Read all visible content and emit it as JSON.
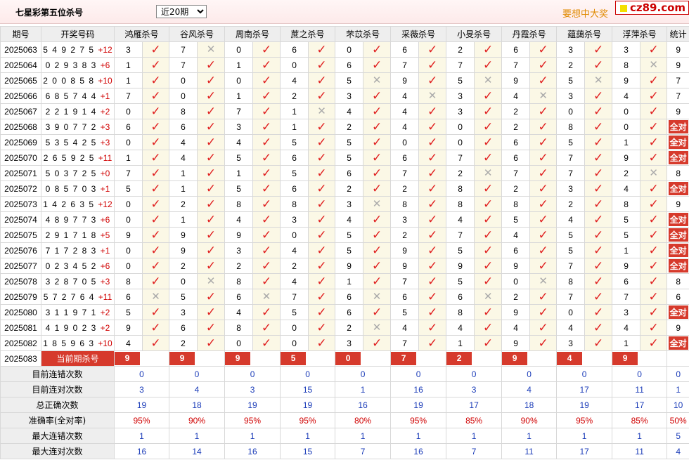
{
  "header": {
    "title": "七星彩第五位杀号",
    "select_value": "近20期",
    "promo": "要想中大奖",
    "logo": "cz89.com"
  },
  "columns": [
    "期号",
    "开奖号码",
    "鸿雁杀号",
    "谷风杀号",
    "周南杀号",
    "蔗之杀号",
    "芣苡杀号",
    "采薇杀号",
    "小旻杀号",
    "丹霞杀号",
    "蕴藹杀号",
    "浮萍杀号",
    "统计"
  ],
  "rows": [
    {
      "issue": "2025063",
      "nums": "5 4 9 2 7 5",
      "plus": "+12",
      "preds": [
        3,
        7,
        0,
        6,
        0,
        6,
        2,
        6,
        3,
        3
      ],
      "marks": [
        1,
        0,
        1,
        1,
        1,
        1,
        1,
        1,
        1,
        1
      ],
      "stat": "9"
    },
    {
      "issue": "2025064",
      "nums": "0 2 9 3 8 3",
      "plus": "+6",
      "preds": [
        1,
        7,
        1,
        0,
        6,
        7,
        7,
        7,
        2,
        8
      ],
      "marks": [
        1,
        1,
        1,
        1,
        1,
        1,
        1,
        1,
        1,
        0
      ],
      "stat": "9"
    },
    {
      "issue": "2025065",
      "nums": "2 0 0 8 5 8",
      "plus": "+10",
      "preds": [
        1,
        0,
        0,
        4,
        5,
        9,
        5,
        9,
        5,
        9
      ],
      "marks": [
        1,
        1,
        1,
        1,
        0,
        1,
        0,
        1,
        0,
        1
      ],
      "stat": "7"
    },
    {
      "issue": "2025066",
      "nums": "6 8 5 7 4 4",
      "plus": "+1",
      "preds": [
        7,
        0,
        1,
        2,
        3,
        4,
        3,
        4,
        3,
        4
      ],
      "marks": [
        1,
        1,
        1,
        1,
        1,
        0,
        1,
        0,
        1,
        1
      ],
      "stat": "7"
    },
    {
      "issue": "2025067",
      "nums": "2 2 1 9 1 4",
      "plus": "+2",
      "preds": [
        0,
        8,
        7,
        1,
        4,
        4,
        3,
        2,
        0,
        0
      ],
      "marks": [
        1,
        1,
        1,
        0,
        1,
        1,
        1,
        1,
        1,
        1
      ],
      "stat": "9"
    },
    {
      "issue": "2025068",
      "nums": "3 9 0 7 7 2",
      "plus": "+3",
      "preds": [
        6,
        6,
        3,
        1,
        2,
        4,
        0,
        2,
        8,
        0
      ],
      "marks": [
        1,
        1,
        1,
        1,
        1,
        1,
        1,
        1,
        1,
        1
      ],
      "stat": "全对"
    },
    {
      "issue": "2025069",
      "nums": "5 3 5 4 2 5",
      "plus": "+3",
      "preds": [
        0,
        4,
        4,
        5,
        5,
        0,
        0,
        6,
        5,
        1
      ],
      "marks": [
        1,
        1,
        1,
        1,
        1,
        1,
        1,
        1,
        1,
        1
      ],
      "stat": "全对"
    },
    {
      "issue": "2025070",
      "nums": "2 6 5 9 2 5",
      "plus": "+11",
      "preds": [
        1,
        4,
        5,
        6,
        5,
        6,
        7,
        6,
        7,
        9
      ],
      "marks": [
        1,
        1,
        1,
        1,
        1,
        1,
        1,
        1,
        1,
        1
      ],
      "stat": "全对"
    },
    {
      "issue": "2025071",
      "nums": "5 0 3 7 2 5",
      "plus": "+0",
      "preds": [
        7,
        1,
        1,
        5,
        6,
        7,
        2,
        7,
        7,
        2
      ],
      "marks": [
        1,
        1,
        1,
        1,
        1,
        1,
        0,
        1,
        1,
        0
      ],
      "stat": "8"
    },
    {
      "issue": "2025072",
      "nums": "0 8 5 7 0 3",
      "plus": "+1",
      "preds": [
        5,
        1,
        5,
        6,
        2,
        2,
        8,
        2,
        3,
        4
      ],
      "marks": [
        1,
        1,
        1,
        1,
        1,
        1,
        1,
        1,
        1,
        1
      ],
      "stat": "全对"
    },
    {
      "issue": "2025073",
      "nums": "1 4 2 6 3 5",
      "plus": "+12",
      "preds": [
        0,
        2,
        8,
        8,
        3,
        8,
        8,
        8,
        2,
        8
      ],
      "marks": [
        1,
        1,
        1,
        1,
        0,
        1,
        1,
        1,
        1,
        1
      ],
      "stat": "9"
    },
    {
      "issue": "2025074",
      "nums": "4 8 9 7 7 3",
      "plus": "+6",
      "preds": [
        0,
        1,
        4,
        3,
        4,
        3,
        4,
        5,
        4,
        5
      ],
      "marks": [
        1,
        1,
        1,
        1,
        1,
        1,
        1,
        1,
        1,
        1
      ],
      "stat": "全对"
    },
    {
      "issue": "2025075",
      "nums": "2 9 1 7 1 8",
      "plus": "+5",
      "preds": [
        9,
        9,
        9,
        0,
        5,
        2,
        7,
        4,
        5,
        5
      ],
      "marks": [
        1,
        1,
        1,
        1,
        1,
        1,
        1,
        1,
        1,
        1
      ],
      "stat": "全对"
    },
    {
      "issue": "2025076",
      "nums": "7 1 7 2 8 3",
      "plus": "+1",
      "preds": [
        0,
        9,
        3,
        4,
        5,
        9,
        5,
        6,
        5,
        1
      ],
      "marks": [
        1,
        1,
        1,
        1,
        1,
        1,
        1,
        1,
        1,
        1
      ],
      "stat": "全对"
    },
    {
      "issue": "2025077",
      "nums": "0 2 3 4 5 2",
      "plus": "+6",
      "preds": [
        0,
        2,
        2,
        2,
        9,
        9,
        9,
        9,
        7,
        9
      ],
      "marks": [
        1,
        1,
        1,
        1,
        1,
        1,
        1,
        1,
        1,
        1
      ],
      "stat": "全对"
    },
    {
      "issue": "2025078",
      "nums": "3 2 8 7 0 5",
      "plus": "+3",
      "preds": [
        8,
        0,
        8,
        4,
        1,
        7,
        5,
        0,
        8,
        6
      ],
      "marks": [
        1,
        0,
        1,
        1,
        1,
        1,
        1,
        0,
        1,
        1
      ],
      "stat": "8"
    },
    {
      "issue": "2025079",
      "nums": "5 7 2 7 6 4",
      "plus": "+11",
      "preds": [
        6,
        5,
        6,
        7,
        6,
        6,
        6,
        2,
        7,
        7
      ],
      "marks": [
        0,
        1,
        0,
        1,
        0,
        1,
        0,
        1,
        1,
        1
      ],
      "stat": "6"
    },
    {
      "issue": "2025080",
      "nums": "3 1 1 9 7 1",
      "plus": "+2",
      "preds": [
        5,
        3,
        4,
        5,
        6,
        5,
        8,
        9,
        0,
        3
      ],
      "marks": [
        1,
        1,
        1,
        1,
        1,
        1,
        1,
        1,
        1,
        1
      ],
      "stat": "全对"
    },
    {
      "issue": "2025081",
      "nums": "4 1 9 0 2 3",
      "plus": "+2",
      "preds": [
        9,
        6,
        8,
        0,
        2,
        4,
        4,
        4,
        4,
        4
      ],
      "marks": [
        1,
        1,
        1,
        1,
        0,
        1,
        1,
        1,
        1,
        1
      ],
      "stat": "9"
    },
    {
      "issue": "2025082",
      "nums": "1 8 5 9 6 3",
      "plus": "+10",
      "preds": [
        4,
        2,
        0,
        0,
        3,
        7,
        1,
        9,
        3,
        1
      ],
      "marks": [
        1,
        1,
        1,
        1,
        1,
        1,
        1,
        1,
        1,
        1
      ],
      "stat": "全对"
    }
  ],
  "current": {
    "issue": "2025083",
    "label": "当前期杀号",
    "kills": [
      9,
      9,
      9,
      5,
      0,
      7,
      2,
      9,
      4,
      9
    ]
  },
  "stats": [
    {
      "label": "目前连错次数",
      "values": [
        "0",
        "0",
        "0",
        "0",
        "0",
        "0",
        "0",
        "0",
        "0",
        "0",
        "0"
      ]
    },
    {
      "label": "目前连对次数",
      "values": [
        "3",
        "4",
        "3",
        "15",
        "1",
        "16",
        "3",
        "4",
        "17",
        "11",
        "1"
      ]
    },
    {
      "label": "总正确次数",
      "values": [
        "19",
        "18",
        "19",
        "19",
        "16",
        "19",
        "17",
        "18",
        "19",
        "17",
        "10"
      ]
    },
    {
      "label": "准确率(全对率)",
      "values": [
        "95%",
        "90%",
        "95%",
        "95%",
        "80%",
        "95%",
        "85%",
        "90%",
        "95%",
        "85%",
        "50%"
      ]
    },
    {
      "label": "最大连错次数",
      "values": [
        "1",
        "1",
        "1",
        "1",
        "1",
        "1",
        "1",
        "1",
        "1",
        "1",
        "5"
      ]
    },
    {
      "label": "最大连对次数",
      "values": [
        "16",
        "14",
        "16",
        "15",
        "7",
        "16",
        "7",
        "11",
        "17",
        "11",
        "4"
      ]
    }
  ],
  "symbols": {
    "ok": "✓",
    "bad": "✕"
  },
  "colors": {
    "accent": "#d63a2c",
    "check": "#e02020",
    "stat_blue": "#1a3bb8",
    "predict_bg": "#fbf8e6",
    "promo": "#e08a00"
  }
}
